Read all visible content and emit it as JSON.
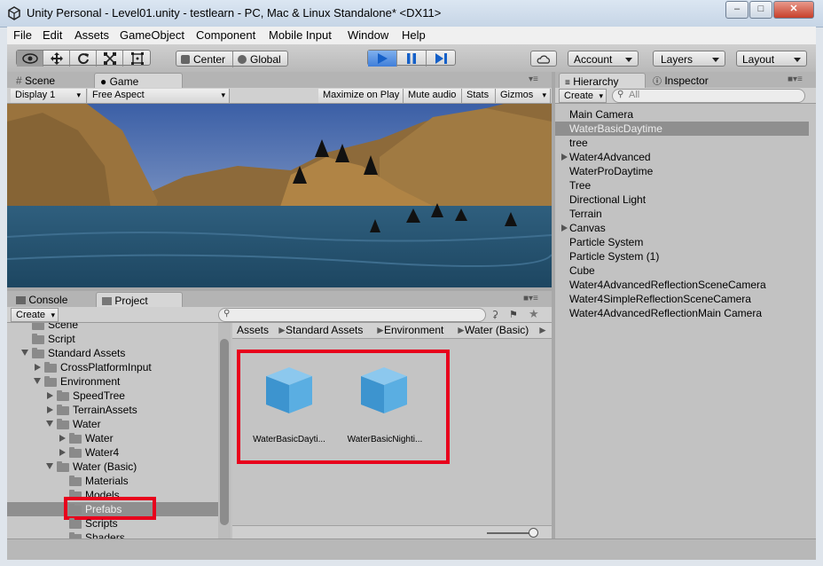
{
  "window": {
    "title": "Unity Personal - Level01.unity - testlearn - PC, Mac & Linux Standalone* <DX11>",
    "min_label": "–",
    "max_label": "□",
    "close_label": "✕"
  },
  "menu": [
    "File",
    "Edit",
    "Assets",
    "GameObject",
    "Component",
    "Mobile Input",
    "Window",
    "Help"
  ],
  "toolbar": {
    "transform_tools": [
      "eye-icon",
      "move-icon",
      "rotate-icon",
      "scale-icon",
      "rect-icon"
    ],
    "pivot_label": "Center",
    "space_label": "Global",
    "play_controls": [
      "play-icon",
      "pause-icon",
      "step-icon"
    ],
    "account_label": "Account",
    "layers_label": "Layers",
    "layout_label": "Layout"
  },
  "view_tabs": {
    "scene": "Scene",
    "game": "Game"
  },
  "game_bar": {
    "display": "Display 1",
    "aspect": "Free Aspect",
    "maximize": "Maximize on Play",
    "mute": "Mute audio",
    "stats": "Stats",
    "gizmos": "Gizmos"
  },
  "hierarchy": {
    "tab_label": "Hierarchy",
    "inspector_label": "Inspector",
    "create_label": "Create",
    "search_placeholder": "All",
    "items": [
      {
        "label": "Main Camera",
        "expandable": false,
        "selected": false
      },
      {
        "label": "WaterBasicDaytime",
        "expandable": false,
        "selected": true
      },
      {
        "label": "tree",
        "expandable": false,
        "selected": false
      },
      {
        "label": "Water4Advanced",
        "expandable": true,
        "selected": false
      },
      {
        "label": "WaterProDaytime",
        "expandable": false,
        "selected": false
      },
      {
        "label": "Tree",
        "expandable": false,
        "selected": false
      },
      {
        "label": "Directional Light",
        "expandable": false,
        "selected": false
      },
      {
        "label": "Terrain",
        "expandable": false,
        "selected": false
      },
      {
        "label": "Canvas",
        "expandable": true,
        "selected": false
      },
      {
        "label": "Particle System",
        "expandable": false,
        "selected": false
      },
      {
        "label": "Particle System (1)",
        "expandable": false,
        "selected": false
      },
      {
        "label": "Cube",
        "expandable": false,
        "selected": false
      },
      {
        "label": "Water4AdvancedReflectionSceneCamera",
        "expandable": false,
        "selected": false
      },
      {
        "label": "Water4SimpleReflectionSceneCamera",
        "expandable": false,
        "selected": false
      },
      {
        "label": "Water4AdvancedReflectionMain Camera",
        "expandable": false,
        "selected": false
      }
    ]
  },
  "bottom_tabs": {
    "console": "Console",
    "project": "Project"
  },
  "project": {
    "create_label": "Create",
    "tree": [
      {
        "label": "Scene",
        "depth": 1,
        "arrow": "none"
      },
      {
        "label": "Script",
        "depth": 1,
        "arrow": "none"
      },
      {
        "label": "Standard Assets",
        "depth": 1,
        "arrow": "open"
      },
      {
        "label": "CrossPlatformInput",
        "depth": 2,
        "arrow": "closed"
      },
      {
        "label": "Environment",
        "depth": 2,
        "arrow": "open"
      },
      {
        "label": "SpeedTree",
        "depth": 3,
        "arrow": "closed"
      },
      {
        "label": "TerrainAssets",
        "depth": 3,
        "arrow": "closed"
      },
      {
        "label": "Water",
        "depth": 3,
        "arrow": "open"
      },
      {
        "label": "Water",
        "depth": 4,
        "arrow": "closed"
      },
      {
        "label": "Water4",
        "depth": 4,
        "arrow": "closed"
      },
      {
        "label": "Water (Basic)",
        "depth": 3,
        "arrow": "open"
      },
      {
        "label": "Materials",
        "depth": 4,
        "arrow": "none"
      },
      {
        "label": "Models",
        "depth": 4,
        "arrow": "none"
      },
      {
        "label": "Prefabs",
        "depth": 4,
        "arrow": "none",
        "selected": true
      },
      {
        "label": "Scripts",
        "depth": 4,
        "arrow": "none"
      },
      {
        "label": "Shaders",
        "depth": 4,
        "arrow": "none"
      }
    ],
    "breadcrumb": [
      "Assets",
      "Standard Assets",
      "Environment",
      "Water (Basic)"
    ],
    "assets": [
      {
        "label": "WaterBasicDayti..."
      },
      {
        "label": "WaterBasicNighti..."
      }
    ]
  },
  "colors": {
    "selection": "#8f8f8f",
    "highlight_box": "#e8001c",
    "play_blue": "#3b7fe0",
    "sky": "#4f6fb0",
    "water": "#2e5a7a",
    "terrain": "#a67c3c"
  }
}
